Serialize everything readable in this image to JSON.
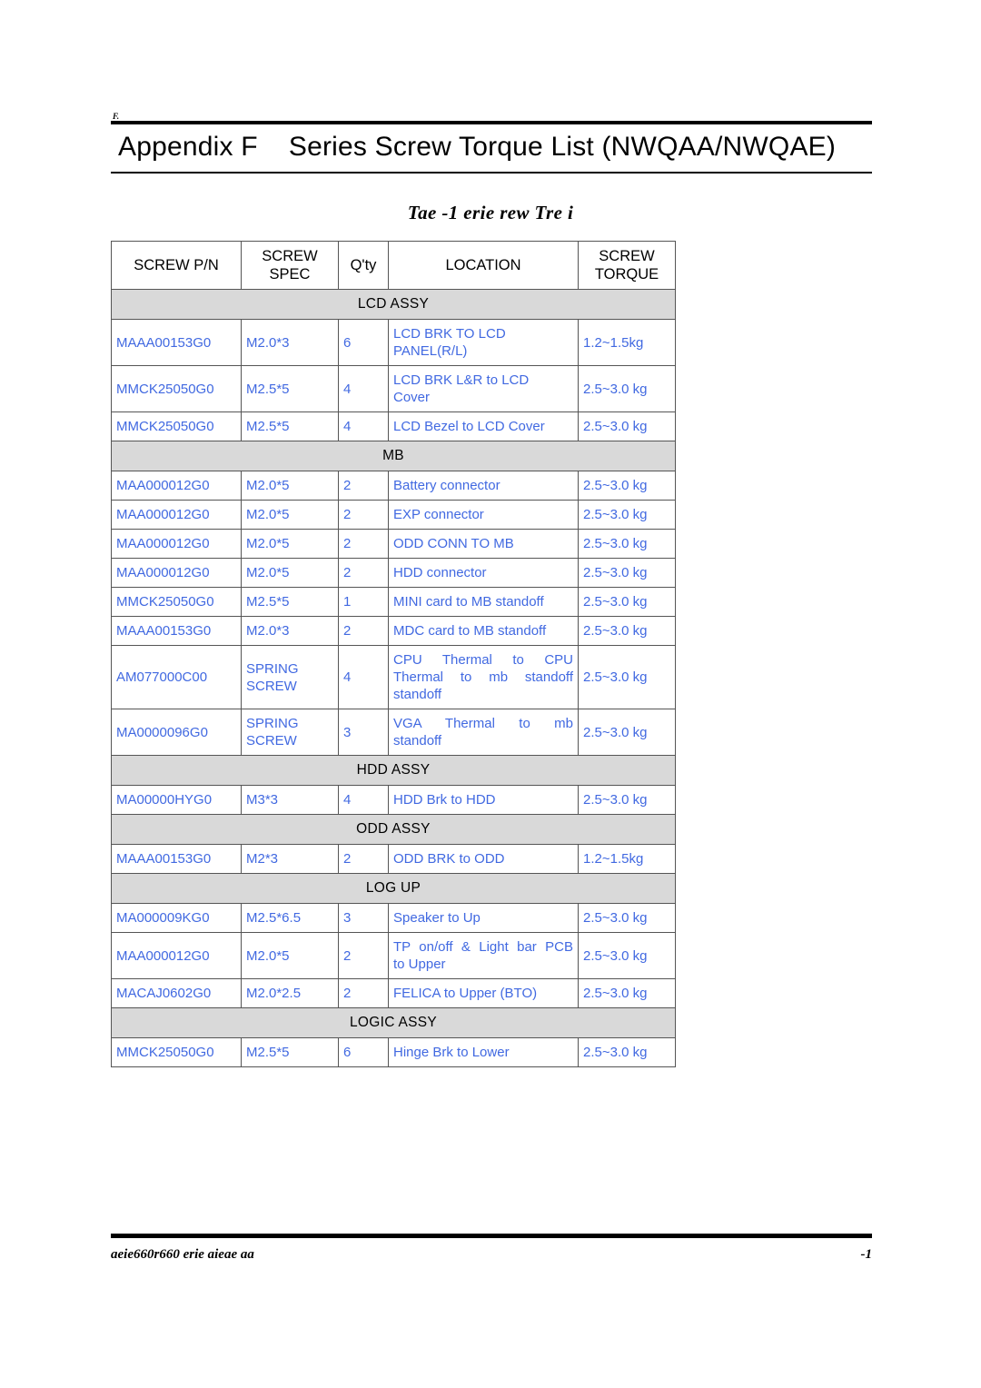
{
  "header": {
    "corner_mark": "F.",
    "title": "Appendix F    Series Screw Torque List (NWQAA/NWQAE)"
  },
  "caption": "Tae -1 erie rew Tre i",
  "table": {
    "columns": [
      {
        "key": "pn",
        "label": "SCREW P/N"
      },
      {
        "key": "spec",
        "label": "SCREW\nSPEC"
      },
      {
        "key": "qty",
        "label": "Q'ty"
      },
      {
        "key": "loc",
        "label": "LOCATION"
      },
      {
        "key": "torq",
        "label": "SCREW\nTORQUE"
      }
    ],
    "sections": [
      {
        "title": "LCD ASSY",
        "rows": [
          {
            "pn": "MAAA00153G0",
            "spec": "M2.0*3",
            "qty": "6",
            "loc": "LCD BRK TO LCD\nPANEL(R/L)",
            "torq": "1.2~1.5kg"
          },
          {
            "pn": "MMCK25050G0",
            "spec": "M2.5*5",
            "qty": "4",
            "loc": "LCD BRK L&R to LCD\nCover",
            "torq": "2.5~3.0 kg"
          },
          {
            "pn": "MMCK25050G0",
            "spec": "M2.5*5",
            "qty": "4",
            "loc": "LCD Bezel to LCD Cover",
            "torq": "2.5~3.0 kg"
          }
        ]
      },
      {
        "title": "MB",
        "rows": [
          {
            "pn": "MAA000012G0",
            "spec": "M2.0*5",
            "qty": "2",
            "loc": "Battery connector",
            "torq": "2.5~3.0 kg"
          },
          {
            "pn": "MAA000012G0",
            "spec": "M2.0*5",
            "qty": "2",
            "loc": "EXP  connector",
            "torq": "2.5~3.0 kg"
          },
          {
            "pn": "MAA000012G0",
            "spec": "M2.0*5",
            "qty": "2",
            "loc": "ODD CONN TO MB",
            "torq": "2.5~3.0 kg"
          },
          {
            "pn": "MAA000012G0",
            "spec": "M2.0*5",
            "qty": "2",
            "loc": "HDD connector",
            "torq": "2.5~3.0 kg"
          },
          {
            "pn": "MMCK25050G0",
            "spec": "M2.5*5",
            "qty": "1",
            "loc": "MINI card  to MB standoff",
            "torq": "2.5~3.0 kg"
          },
          {
            "pn": "MAAA00153G0",
            "spec": "M2.0*3",
            "qty": "2",
            "loc": "MDC card to MB standoff",
            "torq": "2.5~3.0 kg"
          },
          {
            "pn": "AM077000C00",
            "spec": "SPRING\nSCREW",
            "qty": "4",
            "loc": "CPU Thermal to CPU Thermal to mb standoff standoff",
            "loc_lines": [
              "CPU Thermal to CPU",
              "Thermal to mb standoff",
              "standoff"
            ],
            "justified": true,
            "torq": "2.5~3.0 kg"
          },
          {
            "pn": "MA0000096G0",
            "spec": "SPRING\nSCREW",
            "qty": "3",
            "loc": "VGA Thermal to mb standoff",
            "loc_lines": [
              "VGA Thermal to mb",
              "standoff"
            ],
            "justified": true,
            "torq": "2.5~3.0 kg"
          }
        ]
      },
      {
        "title": "HDD ASSY",
        "rows": [
          {
            "pn": "MA00000HYG0",
            "spec": "M3*3",
            "qty": "4",
            "loc": "HDD Brk to HDD",
            "torq": "2.5~3.0 kg"
          }
        ]
      },
      {
        "title": "ODD ASSY",
        "rows": [
          {
            "pn": "MAAA00153G0",
            "spec": "M2*3",
            "qty": "2",
            "loc": "ODD BRK to ODD",
            "torq": "1.2~1.5kg"
          }
        ]
      },
      {
        "title": "LOG UP",
        "rows": [
          {
            "pn": "MA000009KG0",
            "spec": "M2.5*6.5",
            "qty": "3",
            "loc": "Speaker  to Up",
            "torq": "2.5~3.0 kg"
          },
          {
            "pn": "MAA000012G0",
            "spec": "M2.0*5",
            "qty": "2",
            "loc": "TP on/off & Light bar PCB to Upper",
            "loc_lines": [
              "TP on/off & Light bar PCB",
              "to Upper"
            ],
            "justified": true,
            "torq": "2.5~3.0 kg"
          },
          {
            "pn": "MACAJ0602G0",
            "spec": "M2.0*2.5",
            "qty": "2",
            "loc": "FELICA  to Upper  (BTO)",
            "torq": "2.5~3.0 kg"
          }
        ]
      },
      {
        "title": "LOGIC ASSY",
        "rows": [
          {
            "pn": "MMCK25050G0",
            "spec": "M2.5*5",
            "qty": "6",
            "loc": "Hinge Brk  to Lower",
            "torq": "2.5~3.0 kg"
          }
        ]
      }
    ]
  },
  "footer": {
    "left": "aeie660r660 erie aieae aa",
    "right": "-1"
  },
  "colors": {
    "data_text": "#4169E1",
    "section_band": "#d9d9d9",
    "rule": "#000000",
    "border": "#555555"
  }
}
